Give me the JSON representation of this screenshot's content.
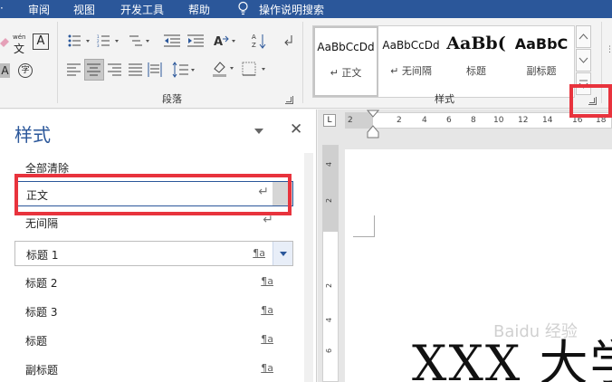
{
  "menu": {
    "items": [
      "审阅",
      "视图",
      "开发工具",
      "帮助"
    ],
    "search": "操作说明搜索"
  },
  "ribbon": {
    "font_group": {
      "wen_top": "wén",
      "wen_char": "文",
      "a_box": "A",
      "a_plain": "A",
      "zi_circle": "字"
    },
    "paragraph_label": "段落",
    "styles_label": "样式",
    "gallery": [
      {
        "sample": "AaBbCcDd",
        "name": "↵ 正文"
      },
      {
        "sample": "AaBbCcDd",
        "name": "↵ 无间隔"
      },
      {
        "sample": "AaBb(",
        "name": "标题"
      },
      {
        "sample": "AaBbC",
        "name": "副标题"
      }
    ]
  },
  "pane": {
    "title": "样式",
    "close": "✕",
    "rows": [
      {
        "label": "全部清除",
        "mark": ""
      },
      {
        "label": "正文",
        "mark": "↵"
      },
      {
        "label": "无间隔",
        "mark": "↵"
      },
      {
        "label": "标题 1",
        "mark": "¶a"
      },
      {
        "label": "标题 2",
        "mark": "¶a"
      },
      {
        "label": "标题 3",
        "mark": "¶a"
      },
      {
        "label": "标题",
        "mark": "¶a"
      },
      {
        "label": "副标题",
        "mark": "¶a"
      }
    ]
  },
  "ruler": {
    "h_ticks": [
      "2",
      "2",
      "4",
      "6",
      "8",
      "10",
      "12",
      "14",
      "16",
      "18"
    ],
    "v_ticks": [
      "4",
      "2",
      "2",
      "4",
      "6"
    ]
  },
  "document": {
    "text": "XXX 大学",
    "watermark": "Baidu 经验"
  },
  "colors": {
    "accent": "#2b579a",
    "highlight": "#e8333d"
  }
}
